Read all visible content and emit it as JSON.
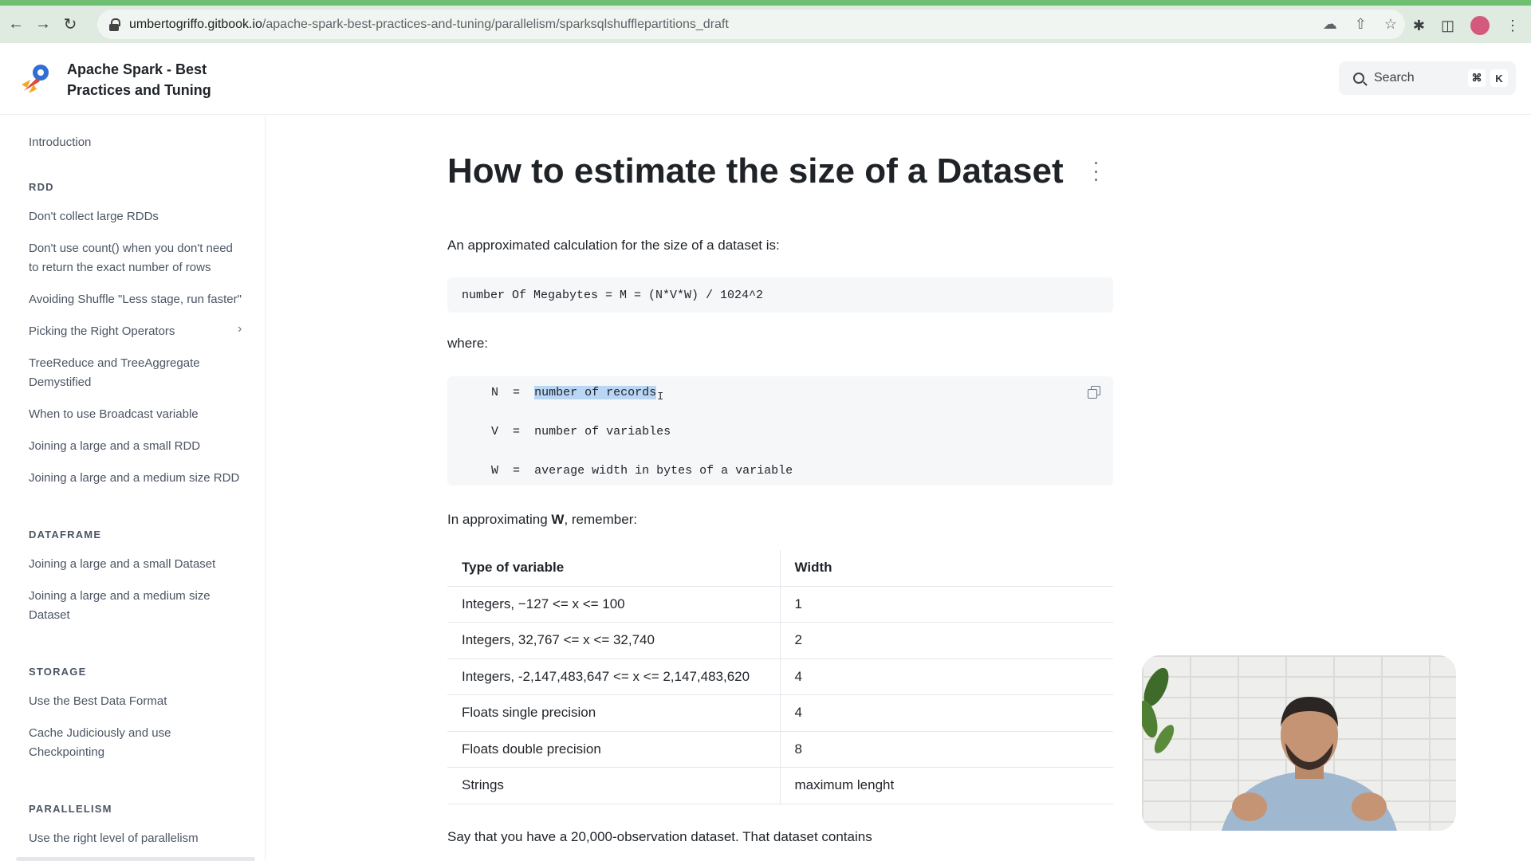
{
  "browser": {
    "url_host": "umbertogriffo.gitbook.io",
    "url_path": "/apache-spark-best-practices-and-tuning/parallelism/sparksqlshufflepartitions_draft"
  },
  "header": {
    "site_title": "Apache Spark - Best Practices and Tuning",
    "search_placeholder": "Search",
    "shortcut_cmd": "⌘",
    "shortcut_key": "K"
  },
  "sidebar": {
    "introduction": "Introduction",
    "sections": [
      {
        "title": "RDD",
        "items": [
          "Don't collect large RDDs",
          "Don't use count() when you don't need to return the exact number of rows",
          "Avoiding Shuffle \"Less stage, run faster\"",
          "Picking the Right Operators",
          "TreeReduce and TreeAggregate Demystified",
          "When to use Broadcast variable",
          "Joining a large and a small RDD",
          "Joining a large and a medium size RDD"
        ]
      },
      {
        "title": "DATAFRAME",
        "items": [
          "Joining a large and a small Dataset",
          "Joining a large and a medium size Dataset"
        ]
      },
      {
        "title": "STORAGE",
        "items": [
          "Use the Best Data Format",
          "Cache Judiciously and use Checkpointing"
        ]
      },
      {
        "title": "PARALLELISM",
        "items": [
          "Use the right level of parallelism"
        ]
      }
    ]
  },
  "main": {
    "title": "How to estimate the size of a Dataset",
    "intro": "An approximated calculation for the size of a dataset is:",
    "formula": "number Of Megabytes = M = (N*V*W) / 1024^2",
    "where": "where:",
    "defs": [
      {
        "sym": "N",
        "eq": "=",
        "desc": "number of records"
      },
      {
        "sym": "V",
        "eq": "=",
        "desc": "number of variables"
      },
      {
        "sym": "W",
        "eq": "=",
        "desc": "average width in bytes of a variable"
      }
    ],
    "approx_prefix": "In approximating ",
    "approx_bold": "W",
    "approx_suffix": ", remember:",
    "table": {
      "headers": [
        "Type of variable",
        "Width"
      ],
      "rows": [
        [
          "Integers, −127 <= x <= 100",
          "1"
        ],
        [
          "Integers, 32,767 <= x <= 32,740",
          "2"
        ],
        [
          "Integers, -2,147,483,647 <= x <= 2,147,483,620",
          "4"
        ],
        [
          "Floats single precision",
          "4"
        ],
        [
          "Floats double precision",
          "8"
        ],
        [
          "Strings",
          "maximum lenght"
        ]
      ]
    },
    "closing": "Say that you have a 20,000-observation dataset. That dataset contains"
  },
  "colors": {
    "progress_bar": "#6fbf73",
    "chrome": "#dfeae0",
    "selection": "#b9d6f5"
  }
}
